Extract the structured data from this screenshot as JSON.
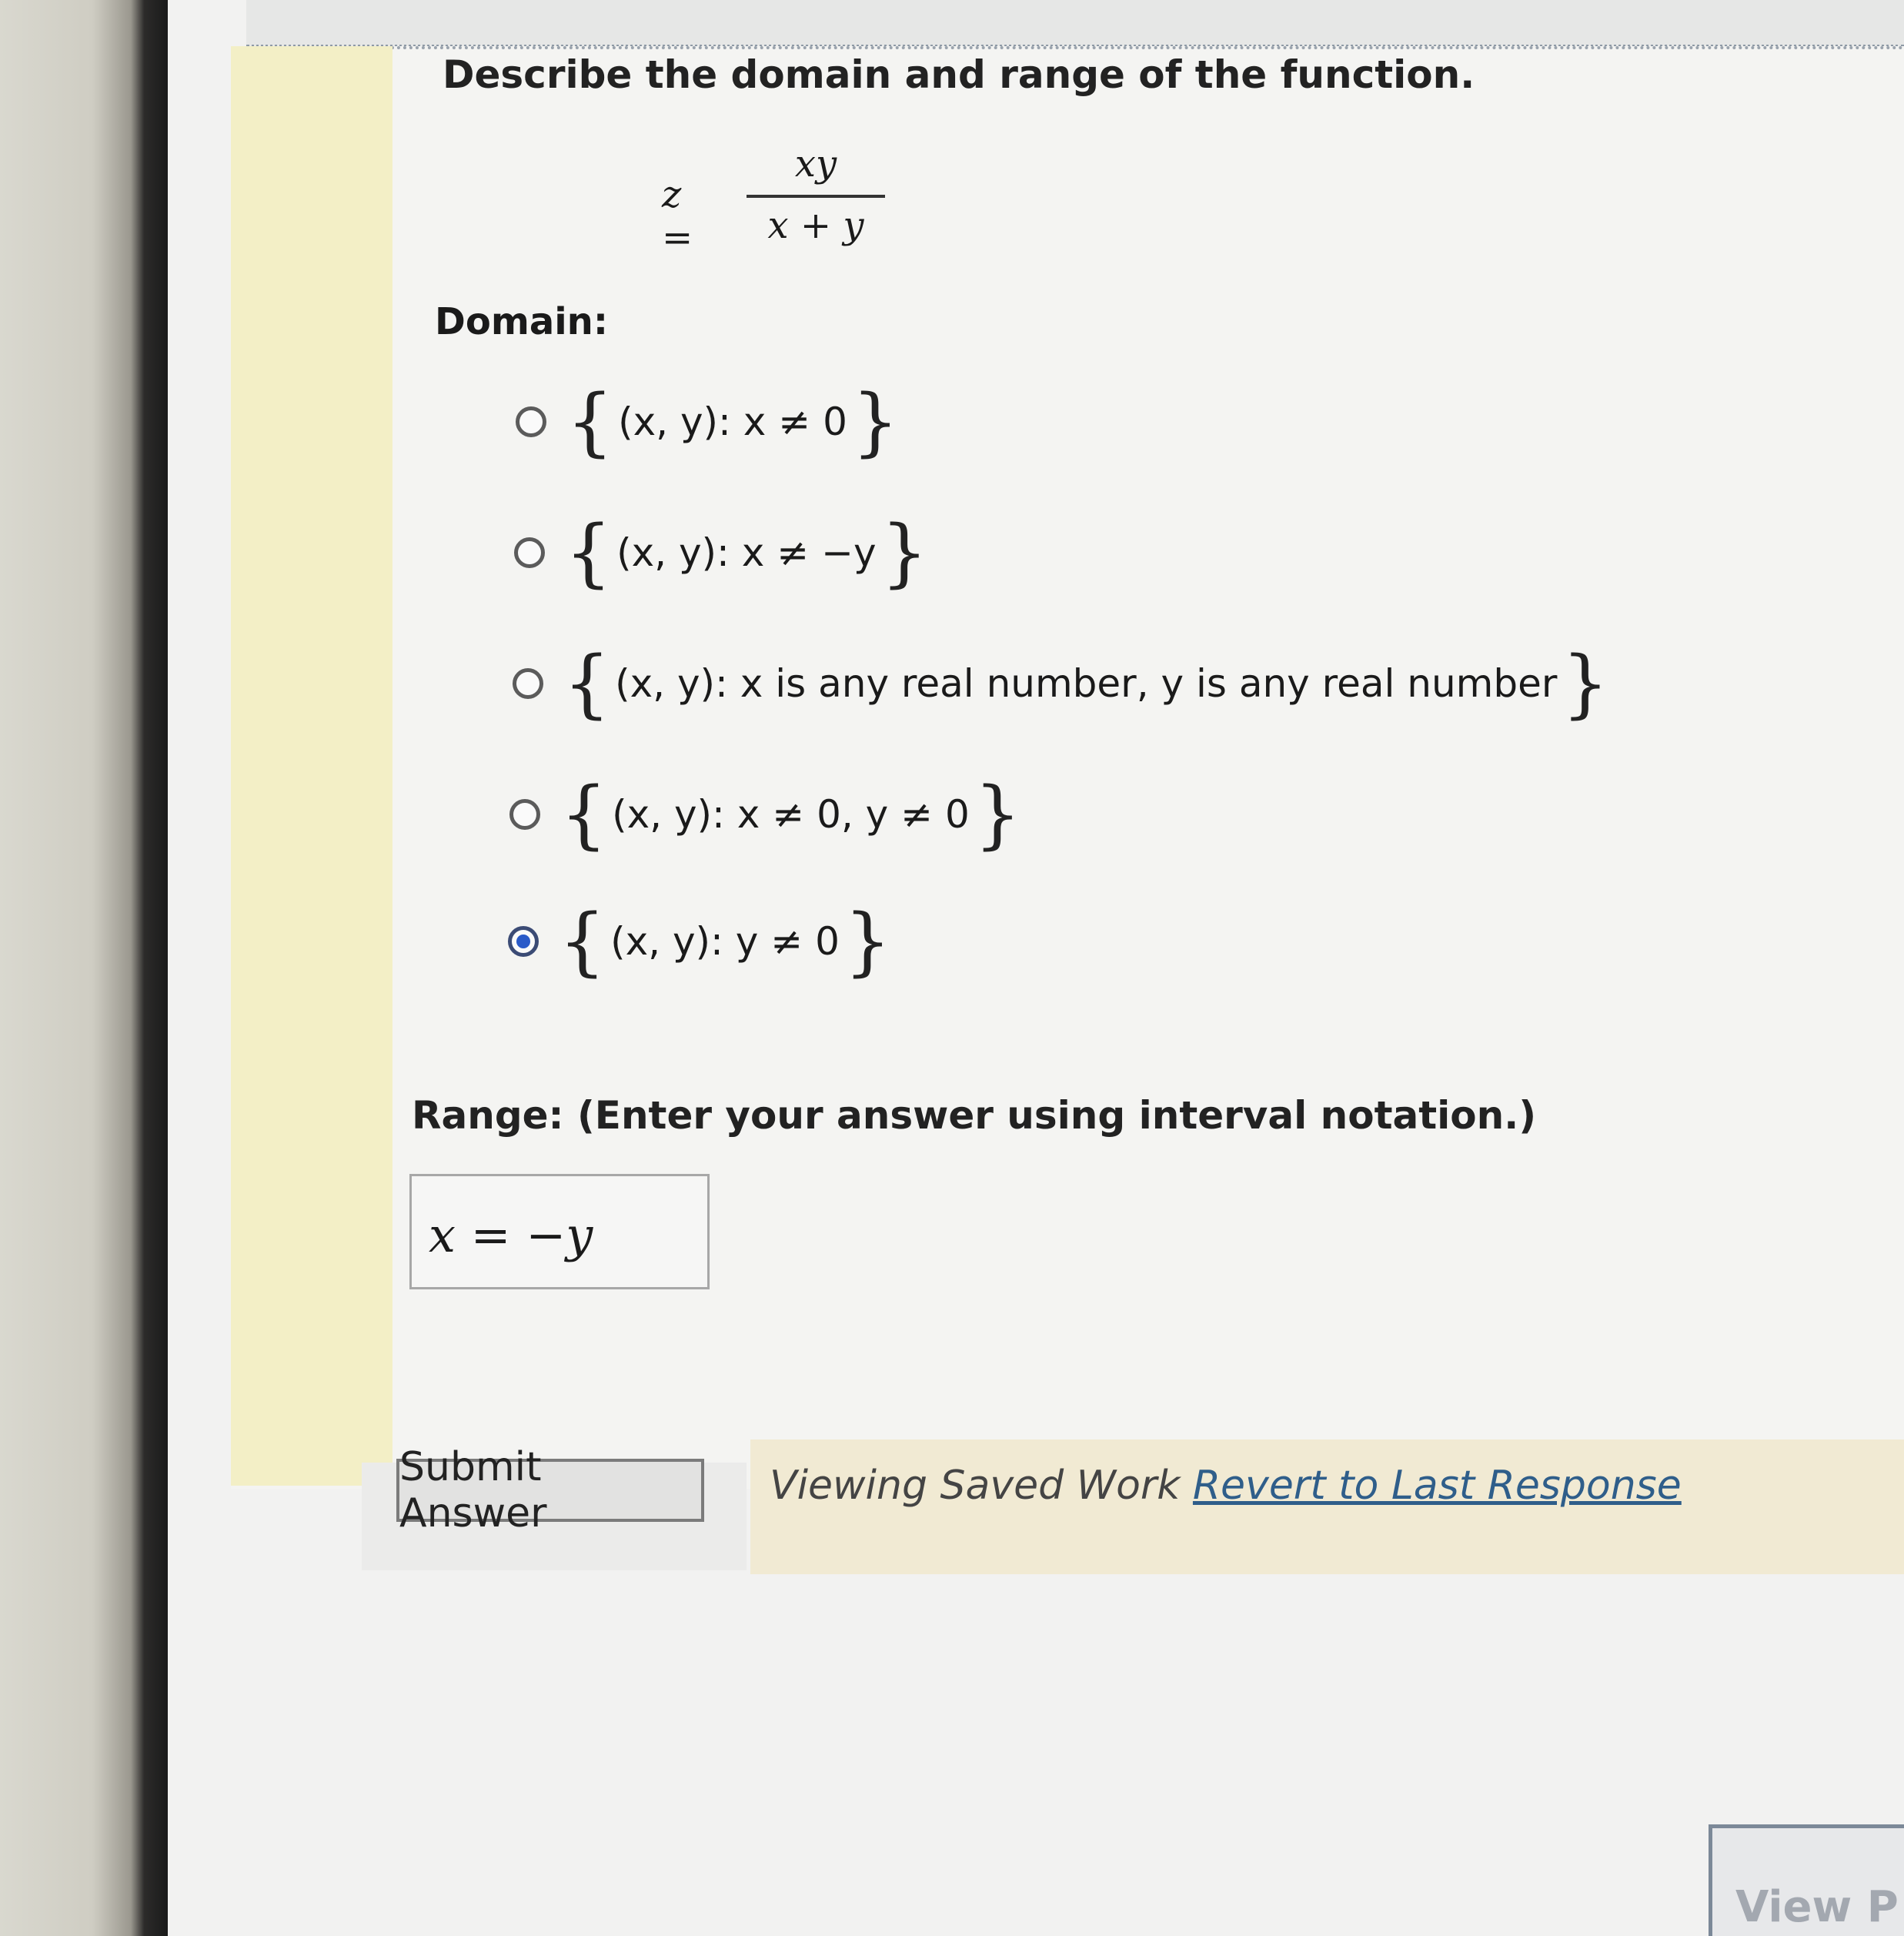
{
  "question": {
    "prompt": "Describe the domain and range of the function.",
    "formula": {
      "lhs": "z =",
      "numerator": "xy",
      "denominator": "x + y"
    },
    "domain_label": "Domain:",
    "domain_options": [
      {
        "text": "(x, y): x ≠ 0",
        "selected": false
      },
      {
        "text": "(x, y): x ≠ −y",
        "selected": false
      },
      {
        "text": "(x, y): x is any real number, y is any real number",
        "selected": false
      },
      {
        "text": "(x, y): x ≠ 0, y ≠ 0",
        "selected": false
      },
      {
        "text": "(x, y): y ≠ 0",
        "selected": true
      }
    ],
    "range_label": "Range: (Enter your answer using interval notation.)",
    "range_value": "x = −y"
  },
  "actions": {
    "submit_label": "Submit Answer",
    "viewing_text": "Viewing Saved Work",
    "revert_link": "Revert to Last Response",
    "view_label": "View P"
  },
  "colors": {
    "accent_radio": "#2a5ac8",
    "link": "#2f5e8a",
    "yellow_bar": "#f3efc6"
  }
}
